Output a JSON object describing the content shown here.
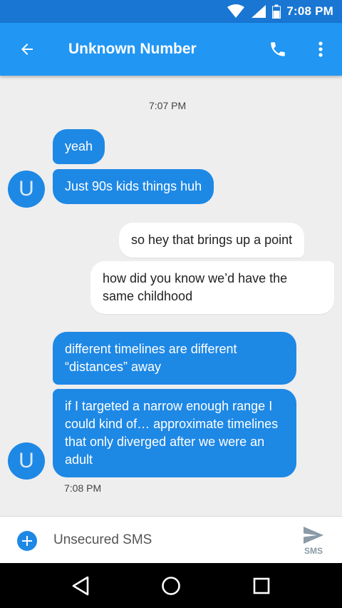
{
  "status_bar": {
    "time": "7:08 PM"
  },
  "toolbar": {
    "title": "Unknown Number",
    "back_icon": "arrow-back",
    "call_icon": "phone",
    "menu_icon": "more-vertical"
  },
  "conversation": {
    "timestamps": [
      "7:07 PM",
      "7:08 PM"
    ],
    "avatar_letter": "U",
    "messages": [
      {
        "direction": "incoming",
        "text": "yeah"
      },
      {
        "direction": "incoming",
        "text": "Just 90s kids things huh"
      },
      {
        "direction": "outgoing",
        "text": "so hey that brings up a point"
      },
      {
        "direction": "outgoing",
        "text": "how did you know we’d have the same childhood"
      },
      {
        "direction": "incoming",
        "text": "different timelines are different “distances” away"
      },
      {
        "direction": "incoming",
        "text": "if I targeted a narrow enough range I could kind of… approximate timelines that only diverged after we were an adult"
      }
    ]
  },
  "compose": {
    "placeholder": "Unsecured SMS",
    "send_label": "SMS",
    "attach_icon": "plus",
    "send_icon": "send"
  },
  "navbar": {
    "icons": [
      "back-triangle",
      "home-circle",
      "recents-square"
    ]
  },
  "colors": {
    "status_bar": "#1976d2",
    "toolbar": "#2196f3",
    "incoming_bubble": "#1e88e5",
    "outgoing_bubble": "#ffffff",
    "background": "#eeeeee"
  }
}
